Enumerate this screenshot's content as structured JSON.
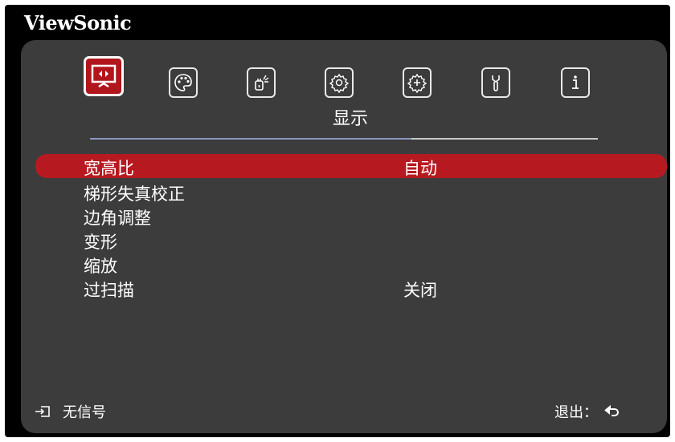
{
  "brand": "ViewSonic",
  "tabs": [
    {
      "name": "display-icon",
      "active": true
    },
    {
      "name": "palette-icon",
      "active": false
    },
    {
      "name": "power-icon",
      "active": false
    },
    {
      "name": "gear-icon",
      "active": false
    },
    {
      "name": "advanced-gear-icon",
      "active": false
    },
    {
      "name": "wrench-icon",
      "active": false
    },
    {
      "name": "info-icon",
      "active": false
    }
  ],
  "active_tab_label": "显示",
  "menu": {
    "items": [
      {
        "label": "宽高比",
        "value": "自动",
        "selected": true
      },
      {
        "label": "梯形失真校正",
        "value": ""
      },
      {
        "label": "边角调整",
        "value": ""
      },
      {
        "label": "变形",
        "value": ""
      },
      {
        "label": "缩放",
        "value": ""
      },
      {
        "label": "过扫描",
        "value": "关闭"
      }
    ]
  },
  "footer": {
    "source_status": "无信号",
    "exit_label": "退出："
  },
  "colors": {
    "accent": "#b61a20",
    "panel": "#3c3c3c",
    "frame": "#000000"
  }
}
